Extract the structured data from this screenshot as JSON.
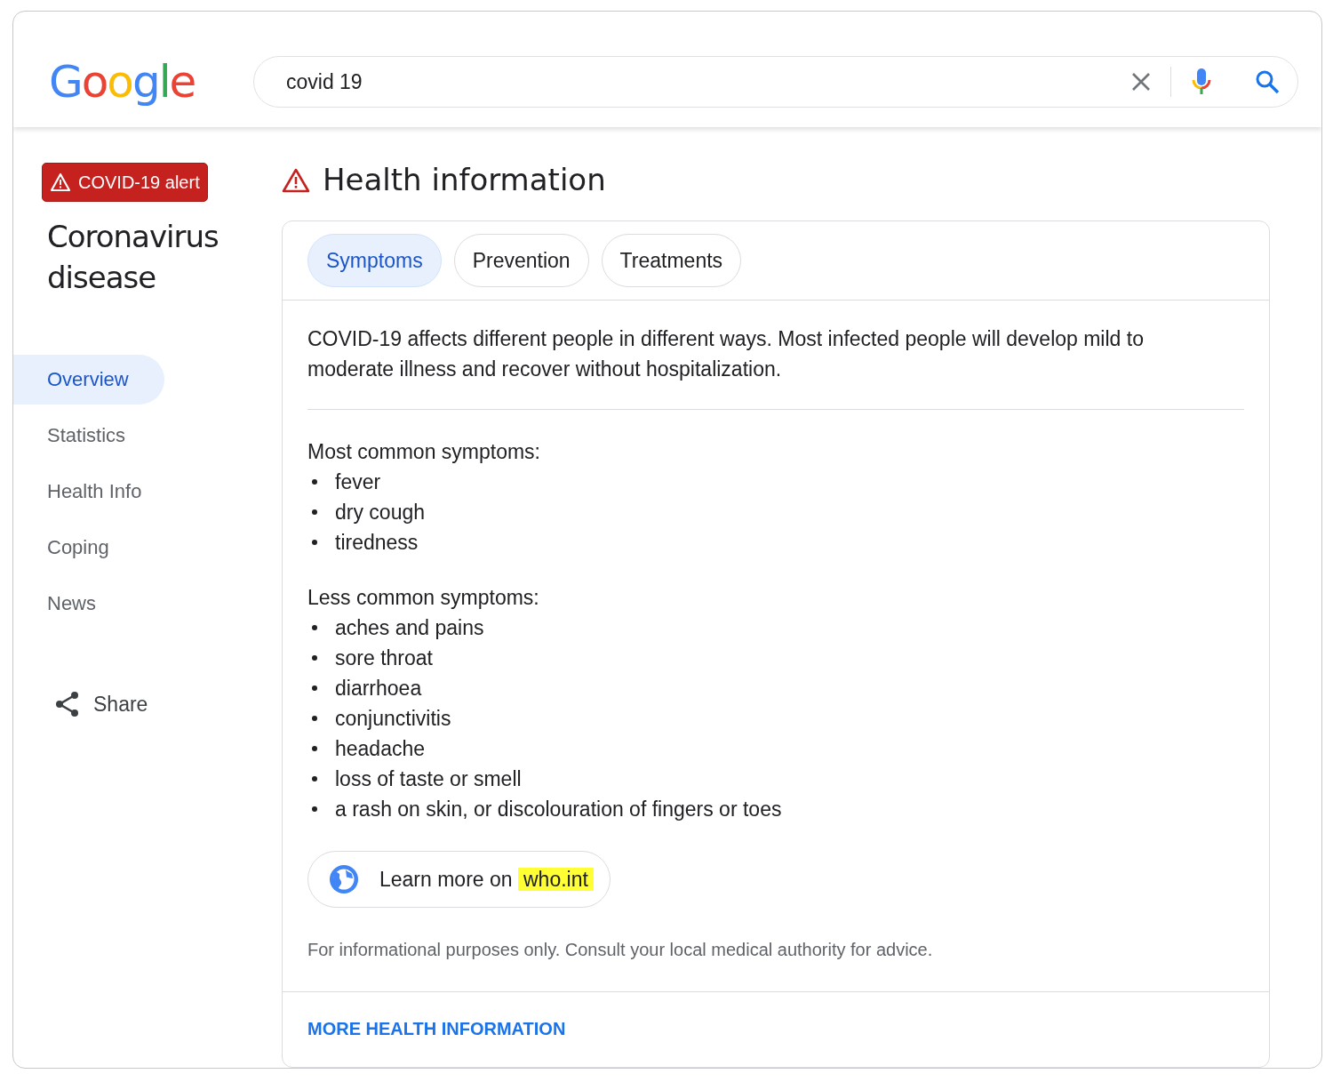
{
  "logo": [
    {
      "text": "G",
      "color": "#4285f4"
    },
    {
      "text": "o",
      "color": "#ea4335"
    },
    {
      "text": "o",
      "color": "#fbbc05"
    },
    {
      "text": "g",
      "color": "#4285f4"
    },
    {
      "text": "l",
      "color": "#34a853"
    },
    {
      "text": "e",
      "color": "#ea4335"
    }
  ],
  "search": {
    "value": "covid 19"
  },
  "sidebar": {
    "alert": "COVID-19 alert",
    "title": "Coronavirus disease",
    "items": [
      {
        "label": "Overview",
        "selected": true
      },
      {
        "label": "Statistics",
        "selected": false
      },
      {
        "label": "Health Info",
        "selected": false
      },
      {
        "label": "Coping",
        "selected": false
      },
      {
        "label": "News",
        "selected": false
      }
    ],
    "share": "Share"
  },
  "heading": "Health information",
  "tabs": [
    {
      "label": "Symptoms",
      "selected": true
    },
    {
      "label": "Prevention",
      "selected": false
    },
    {
      "label": "Treatments",
      "selected": false
    }
  ],
  "intro": "COVID-19 affects different people in different ways. Most infected people will develop mild to moderate illness and recover without hospitalization.",
  "sections": [
    {
      "title": "Most common symptoms:",
      "items": [
        "fever",
        "dry cough",
        "tiredness"
      ]
    },
    {
      "title": "Less common symptoms:",
      "items": [
        "aches and pains",
        "sore throat",
        "diarrhoea",
        "conjunctivitis",
        "headache",
        "loss of taste or smell",
        "a rash on skin, or discolouration of fingers or toes"
      ]
    }
  ],
  "learn_more": {
    "text": "Learn more on",
    "highlight": "who.int"
  },
  "disclaimer": "For informational purposes only. Consult your local medical authority for advice.",
  "more_link": "MORE HEALTH INFORMATION"
}
